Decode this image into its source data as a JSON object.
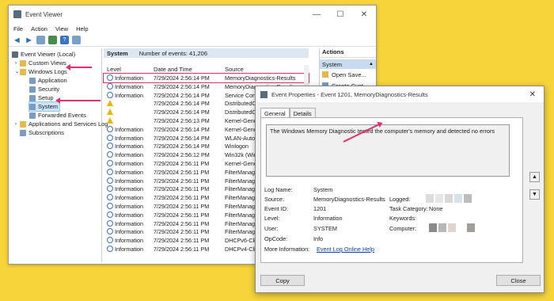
{
  "window": {
    "title": "Event Viewer",
    "menu": [
      "File",
      "Action",
      "View",
      "Help"
    ]
  },
  "tree": [
    {
      "label": "Event Viewer (Local)",
      "icon": "root"
    },
    {
      "label": "Custom Views",
      "icon": "folder"
    },
    {
      "label": "Windows Logs",
      "icon": "folder"
    },
    {
      "label": "Application",
      "icon": "log"
    },
    {
      "label": "Security",
      "icon": "log"
    },
    {
      "label": "Setup",
      "icon": "log"
    },
    {
      "label": "System",
      "icon": "log",
      "selected": true
    },
    {
      "label": "Forwarded Events",
      "icon": "log"
    },
    {
      "label": "Applications and Services Log",
      "icon": "folder"
    },
    {
      "label": "Subscriptions",
      "icon": "log"
    }
  ],
  "center": {
    "panel_title": "System",
    "event_count": "Number of events: 41,206",
    "columns": {
      "level": "Level",
      "date": "Date and Time",
      "source": "Source"
    },
    "rows": [
      {
        "level": "Information",
        "date": "7/29/2024 2:56:14 PM",
        "source": "MemoryDiagnostics-Results",
        "type": "info"
      },
      {
        "level": "Information",
        "date": "7/29/2024 2:56:14 PM",
        "source": "MemoryDiagnostics-Results",
        "type": "info"
      },
      {
        "level": "Information",
        "date": "7/29/2024 2:56:14 PM",
        "source": "Service Contr",
        "type": "info"
      },
      {
        "level": "",
        "date": "7/29/2024 2:56:14 PM",
        "source": "DistributedCO",
        "type": "warn"
      },
      {
        "level": "",
        "date": "7/29/2024 2:56:14 PM",
        "source": "DistributedCO",
        "type": "warn"
      },
      {
        "level": "",
        "date": "7/29/2024 2:56:13 PM",
        "source": "Kernel-Gene",
        "type": "warn"
      },
      {
        "level": "Information",
        "date": "7/29/2024 2:56:14 PM",
        "source": "Kernel-Gene",
        "type": "info"
      },
      {
        "level": "Information",
        "date": "7/29/2024 2:56:14 PM",
        "source": "WLAN-Auto",
        "type": "info"
      },
      {
        "level": "Information",
        "date": "7/29/2024 2:56:14 PM",
        "source": "Winlogon",
        "type": "info"
      },
      {
        "level": "Information",
        "date": "7/29/2024 2:56:12 PM",
        "source": "Win32k (Win",
        "type": "info"
      },
      {
        "level": "Information",
        "date": "7/29/2024 2:56:11 PM",
        "source": "Kernel-Gene",
        "type": "info"
      },
      {
        "level": "Information",
        "date": "7/29/2024 2:56:11 PM",
        "source": "FilterManag",
        "type": "info"
      },
      {
        "level": "Information",
        "date": "7/29/2024 2:56:11 PM",
        "source": "FilterManag",
        "type": "info"
      },
      {
        "level": "Information",
        "date": "7/29/2024 2:56:11 PM",
        "source": "FilterManag",
        "type": "info"
      },
      {
        "level": "Information",
        "date": "7/29/2024 2:56:11 PM",
        "source": "FilterManag",
        "type": "info"
      },
      {
        "level": "Information",
        "date": "7/29/2024 2:56:11 PM",
        "source": "FilterManag",
        "type": "info"
      },
      {
        "level": "Information",
        "date": "7/29/2024 2:56:11 PM",
        "source": "FilterManag",
        "type": "info"
      },
      {
        "level": "Information",
        "date": "7/29/2024 2:56:11 PM",
        "source": "FilterManag",
        "type": "info"
      },
      {
        "level": "Information",
        "date": "7/29/2024 2:56:11 PM",
        "source": "FilterManag",
        "type": "info"
      },
      {
        "level": "Information",
        "date": "7/29/2024 2:56:11 PM",
        "source": "DHCPv6-Clie",
        "type": "info"
      },
      {
        "level": "Information",
        "date": "7/29/2024 2:56:11 PM",
        "source": "DHCPv4-Clie",
        "type": "info"
      }
    ]
  },
  "actions": {
    "title": "Actions",
    "section": "System",
    "items": [
      "Open Save...",
      "Create Cust..."
    ]
  },
  "dialog": {
    "title": "Event Properties - Event 1201, MemoryDiagnostics-Results",
    "tabs": [
      "General",
      "Details"
    ],
    "description": "The Windows Memory Diagnostic tested the computer's memory and detected no errors",
    "labels": {
      "log_name": "Log Name:",
      "source": "Source:",
      "event_id": "Event ID:",
      "level": "Level:",
      "user": "User:",
      "opcode": "OpCode:",
      "more_info": "More Information:",
      "logged": "Logged:",
      "task_category": "Task Category:",
      "keywords": "Keywords:",
      "computer": "Computer:"
    },
    "values": {
      "log_name": "System",
      "source": "MemoryDiagnostics-Results",
      "event_id": "1201",
      "level": "Information",
      "user": "SYSTEM",
      "opcode": "Info",
      "more_info_link": "Event Log Online Help",
      "task_category": "None"
    },
    "buttons": {
      "copy": "Copy",
      "close": "Close"
    }
  },
  "colors": {
    "accent": "#e0306a",
    "background": "#f7d53a",
    "selection": "#cce4f7"
  }
}
